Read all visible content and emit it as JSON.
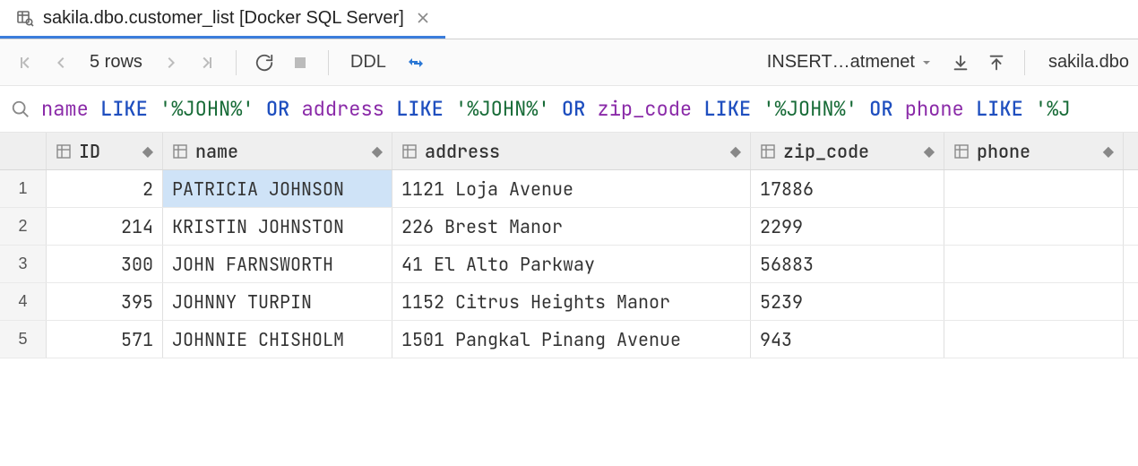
{
  "tab": {
    "title": "sakila.dbo.customer_list [Docker SQL Server]"
  },
  "toolbar": {
    "rows_label": "5 rows",
    "ddl_label": "DDL",
    "insert_label": "INSERT…atmenet",
    "breadcrumb": "sakila.dbo"
  },
  "filter": {
    "tokens": [
      {
        "t": "ident",
        "v": "name"
      },
      {
        "t": "sp"
      },
      {
        "t": "kw",
        "v": "LIKE"
      },
      {
        "t": "sp"
      },
      {
        "t": "str",
        "v": "'%JOHN%'"
      },
      {
        "t": "sp"
      },
      {
        "t": "kw",
        "v": "OR"
      },
      {
        "t": "sp"
      },
      {
        "t": "ident",
        "v": "address"
      },
      {
        "t": "sp"
      },
      {
        "t": "kw",
        "v": "LIKE"
      },
      {
        "t": "sp"
      },
      {
        "t": "str",
        "v": "'%JOHN%'"
      },
      {
        "t": "sp"
      },
      {
        "t": "kw",
        "v": "OR"
      },
      {
        "t": "sp"
      },
      {
        "t": "ident",
        "v": "zip_code"
      },
      {
        "t": "sp"
      },
      {
        "t": "kw",
        "v": "LIKE"
      },
      {
        "t": "sp"
      },
      {
        "t": "str",
        "v": "'%JOHN%'"
      },
      {
        "t": "sp"
      },
      {
        "t": "kw",
        "v": "OR"
      },
      {
        "t": "sp"
      },
      {
        "t": "ident",
        "v": "phone"
      },
      {
        "t": "sp"
      },
      {
        "t": "kw",
        "v": "LIKE"
      },
      {
        "t": "sp"
      },
      {
        "t": "str",
        "v": "'%J"
      }
    ]
  },
  "columns": [
    {
      "key": "ID",
      "label": "ID"
    },
    {
      "key": "name",
      "label": "name"
    },
    {
      "key": "address",
      "label": "address"
    },
    {
      "key": "zip_code",
      "label": "zip_code"
    },
    {
      "key": "phone",
      "label": "phone"
    }
  ],
  "rows": [
    {
      "n": "1",
      "ID": "2",
      "name": "PATRICIA JOHNSON",
      "address": "1121 Loja Avenue",
      "zip_code": "17886",
      "phone": ""
    },
    {
      "n": "2",
      "ID": "214",
      "name": "KRISTIN JOHNSTON",
      "address": "226 Brest Manor",
      "zip_code": "2299",
      "phone": ""
    },
    {
      "n": "3",
      "ID": "300",
      "name": "JOHN FARNSWORTH",
      "address": "41 El Alto Parkway",
      "zip_code": "56883",
      "phone": ""
    },
    {
      "n": "4",
      "ID": "395",
      "name": "JOHNNY TURPIN",
      "address": "1152 Citrus Heights Manor",
      "zip_code": "5239",
      "phone": ""
    },
    {
      "n": "5",
      "ID": "571",
      "name": "JOHNNIE CHISHOLM",
      "address": "1501 Pangkal Pinang Avenue",
      "zip_code": "943",
      "phone": ""
    }
  ],
  "selected": {
    "row": 0,
    "col": "name"
  }
}
